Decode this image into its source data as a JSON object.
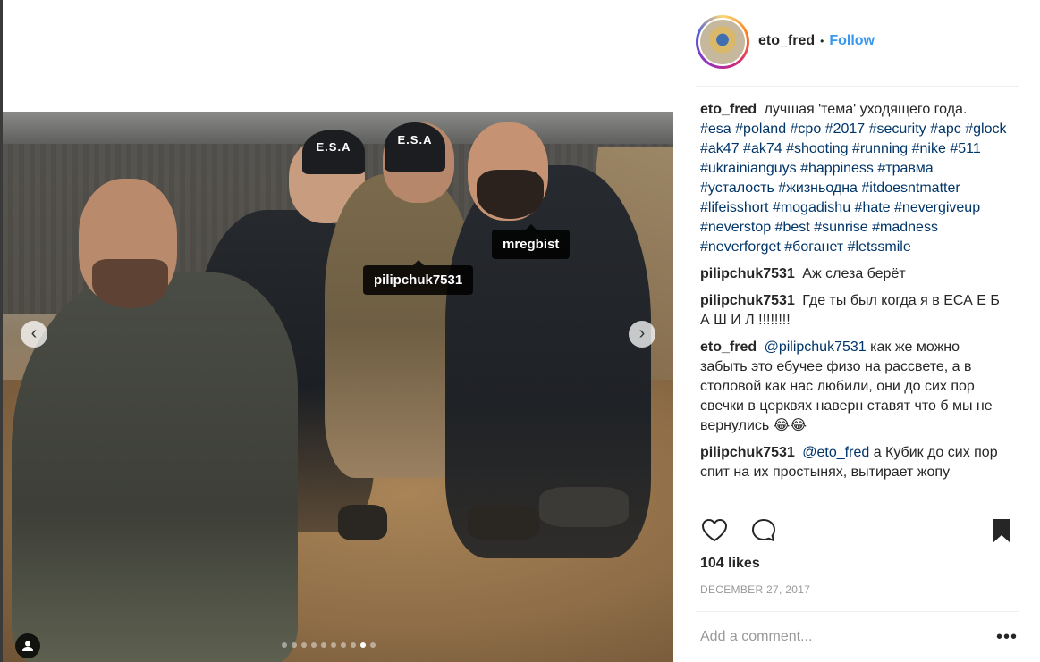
{
  "post": {
    "username": "eto_fred",
    "follow_label": "Follow",
    "separator": "•",
    "avatar_alt": "eto_fred profile picture"
  },
  "photo": {
    "cap_text_1": "E.S.A",
    "cap_text_2": "E.S.A",
    "tags": [
      "pilipchuk7531",
      "mregbist"
    ],
    "prev_glyph": "‹",
    "next_glyph": "›",
    "dots_total": 10,
    "dots_active_index": 8
  },
  "caption": {
    "username": "eto_fred",
    "text": "лучшая 'тема' уходящего года.",
    "hashtags": "#esa #poland #cpo #2017 #security #apc #glock #ak47 #ak74 #shooting #running #nike #511 #ukrainianguys #happiness #травма #усталость #жизньодна #itdoesntmatter #lifeisshort #mogadishu #hate #nevergiveup #neverstop #best #sunrise #madness #neverforget #боганет #letssmile"
  },
  "comments": [
    {
      "username": "pilipchuk7531",
      "mention": "",
      "text": "Аж слеза берёт"
    },
    {
      "username": "pilipchuk7531",
      "mention": "",
      "text": "Где ты был когда я в ЕСА Е Б А Ш И Л !!!!!!!!"
    },
    {
      "username": "eto_fred",
      "mention": "@pilipchuk7531",
      "text": "как же можно забыть это ебучее физо на рассвете, а в столовой как нас любили, они до сих пор свечки в церквях наверн ставят что б мы не вернулись 😂😂"
    },
    {
      "username": "pilipchuk7531",
      "mention": "@eto_fred",
      "text": "а Кубик до сих пор спит на их простынях, вытирает жопу"
    }
  ],
  "stats": {
    "likes": "104 likes",
    "date": "DECEMBER 27, 2017"
  },
  "add_comment": {
    "placeholder": "Add a comment...",
    "more_glyph": "•••"
  },
  "colors": {
    "link": "#3897f0",
    "hashtag": "#003569",
    "text": "#262626",
    "muted": "#999999"
  },
  "icons": [
    "heart-icon",
    "comment-icon",
    "bookmark-icon",
    "chevron-left-icon",
    "chevron-right-icon",
    "user-tag-icon",
    "more-icon"
  ]
}
